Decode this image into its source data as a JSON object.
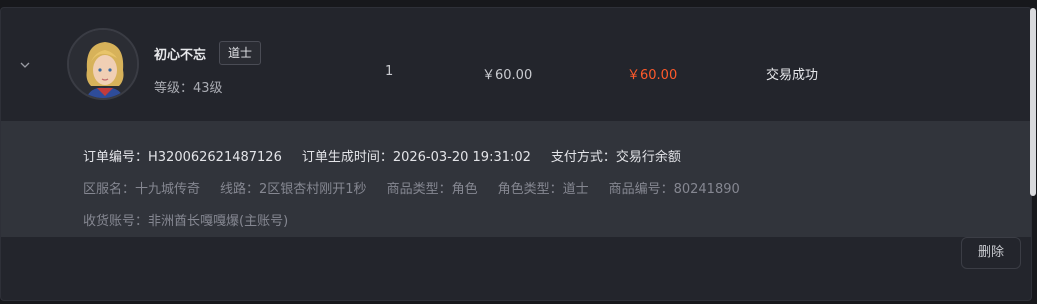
{
  "order": {
    "character_name": "初心不忘",
    "class_badge": "道士",
    "level": "等级：43级",
    "quantity": "1",
    "unit_price": "￥60.00",
    "total_price": "￥60.00",
    "status": "交易成功"
  },
  "details": {
    "order_no": "订单编号：H320062621487126",
    "created_time": "订单生成时间：2026-03-20 19:31:02",
    "payment": "支付方式：交易行余额",
    "server": "区服名：十九城传奇",
    "line": "线路：2区银杏村刚开1秒",
    "product_type": "商品类型：角色",
    "role_type": "角色类型：道士",
    "product_no": "商品编号：80241890",
    "receive_account": "收货账号：非洲酋长嘎嘎爆(主账号)"
  },
  "actions": {
    "delete_label": "删除"
  },
  "colors": {
    "total_price": "#ff5a2b",
    "background": "#23252c",
    "detail_bg": "#31343b"
  }
}
